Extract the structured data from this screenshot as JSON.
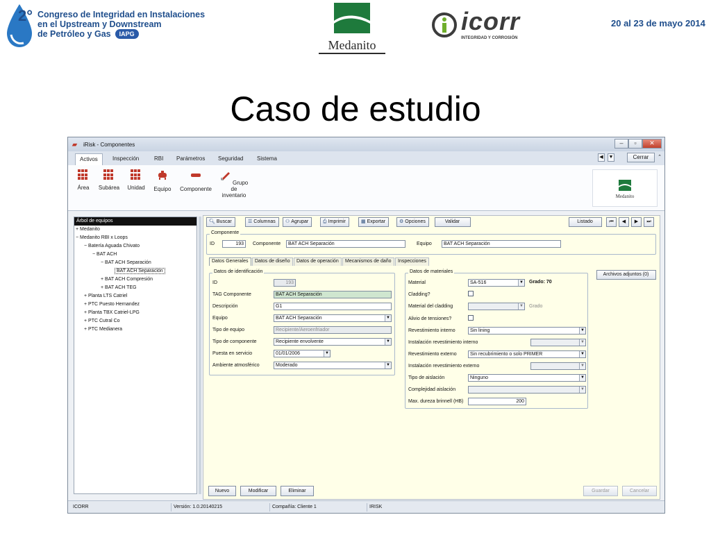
{
  "header": {
    "congress_number": "2°",
    "congress_line1": "Congreso de Integridad en Instalaciones",
    "congress_line2": "en el Upstream y Downstream",
    "congress_line3": "de Petróleo y Gas",
    "iapg_badge": "IAPG",
    "medanito_logo": "Medanito",
    "icorr_logo": "icorr",
    "icorr_tagline": "INTEGRIDAD Y CORROSIÓN",
    "date": "20 al 23 de mayo 2014"
  },
  "slide_title": "Caso de estudio",
  "window": {
    "title": "iRisk - Componentes",
    "close_label": "Cerrar",
    "menu_tabs": [
      "Activos",
      "Inspección",
      "RBI",
      "Parámetros",
      "Seguridad",
      "Sistema"
    ],
    "ribbon_buttons": [
      {
        "label": "Área",
        "icon": "grid-icon"
      },
      {
        "label": "Subárea",
        "icon": "grid-icon"
      },
      {
        "label": "Unidad",
        "icon": "grid-icon"
      },
      {
        "label": "Equipo",
        "icon": "vessel-icon"
      },
      {
        "label": "Componente",
        "icon": "pipe-icon"
      },
      {
        "label": "Grupo de",
        "label2": "inventario",
        "icon": "edit-icon"
      }
    ],
    "ribbon_logo": "Medanito"
  },
  "tree": {
    "header": "Árbol de equipos",
    "items": [
      {
        "label": "Medanito",
        "expander": "+"
      },
      {
        "label": "Medanito RBI x Loops",
        "expander": "−"
      },
      {
        "label": "Batería Aguada Chivato",
        "expander": "−"
      },
      {
        "label": "BAT ACH",
        "expander": "−"
      },
      {
        "label": "BAT ACH Separación",
        "expander": "−"
      },
      {
        "label": "BAT ACH Separación",
        "expander": ""
      },
      {
        "label": "BAT ACH Compresión",
        "expander": "+"
      },
      {
        "label": "BAT ACH TEG",
        "expander": "+"
      },
      {
        "label": "Planta LTS Catriel",
        "expander": "+"
      },
      {
        "label": "PTC Puesto Hernandez",
        "expander": "+"
      },
      {
        "label": "Planta TBX Catriel-LPG",
        "expander": "+"
      },
      {
        "label": "PTC Cutral Co",
        "expander": "+"
      },
      {
        "label": "PTC Medianera",
        "expander": "+"
      }
    ]
  },
  "toolbar": {
    "buscar": "Buscar",
    "columnas": "Columnas",
    "agrupar": "Agrupar",
    "imprimir": "Imprimir",
    "exportar": "Exportar",
    "opciones": "Opciones",
    "validar": "Validar",
    "listado": "Listado"
  },
  "componente_box": {
    "legend": "Componente",
    "id_label": "ID",
    "id_value": "193",
    "componente_label": "Componente",
    "componente_value": "BAT ACH Separación",
    "equipo_label": "Equipo",
    "equipo_value": "BAT ACH Separación"
  },
  "detail_tabs": [
    "Datos Generales",
    "Datos de diseño",
    "Datos de operación",
    "Mecanismos de daño",
    "Inspecciones"
  ],
  "identificacion": {
    "legend": "Datos de identificación",
    "id_label": "ID",
    "id_value": "193",
    "tag_label": "TAG Componente",
    "tag_value": "BAT ACH Separación",
    "descripcion_label": "Descripción",
    "descripcion_value": "G1",
    "equipo_label": "Equipo",
    "equipo_value": "BAT ACH Separación",
    "tipo_equipo_label": "Tipo de equipo",
    "tipo_equipo_value": "Recipiente/Aeroenfriador",
    "tipo_componente_label": "Tipo de componente",
    "tipo_componente_value": "Recipiente envolvente",
    "puesta_label": "Puesta en servicio",
    "puesta_value": "01/01/2006",
    "ambiente_label": "Ambiente atmosférico",
    "ambiente_value": "Moderado"
  },
  "materiales": {
    "legend": "Datos de materiales",
    "material_label": "Material",
    "material_value": "SA-516",
    "grado_label": "Grado: 70",
    "cladding_label": "Cladding?",
    "material_cladding_label": "Material del cladding",
    "grado_cladding_label": "Grado",
    "alivio_label": "Alivio de tensiones?",
    "rev_interno_label": "Revestimiento interno",
    "rev_interno_value": "Sin lining",
    "inst_rev_interno_label": "Instalación revestimiento interno",
    "rev_externo_label": "Revestimiento externo",
    "rev_externo_value": "Sin recubrimiento o solo PRIMER",
    "inst_rev_externo_label": "Instalación revestimiento externo",
    "aislacion_label": "Tipo de aislación",
    "aislacion_value": "Ninguno",
    "complejidad_label": "Complejidad aislación",
    "dureza_label": "Max. dureza brinnell (HB)",
    "dureza_value": "200"
  },
  "archivos_button": "Archivos adjuntos (0)",
  "bottom": {
    "nuevo": "Nuevo",
    "modificar": "Modificar",
    "eliminar": "Eliminar",
    "guardar": "Guardar",
    "cancelar": "Cancelar"
  },
  "status": {
    "company": "ICORR",
    "version": "Versión: 1.0.20140215",
    "compania": "Compañía: Cliente 1",
    "app": "IRISK"
  }
}
